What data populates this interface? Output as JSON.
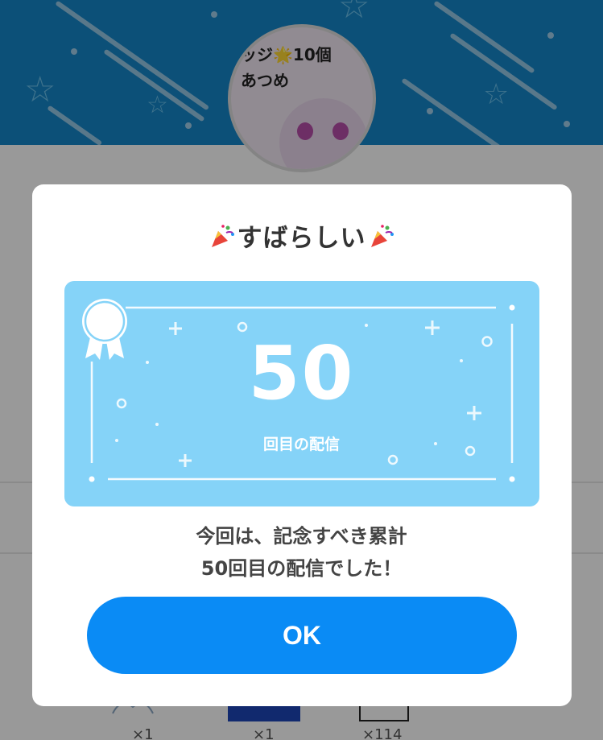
{
  "background": {
    "avatar_text_line1": "ッジ🌟10個",
    "avatar_text_line2": "あつめ",
    "gift_counts": [
      "×1",
      "×1",
      "×114"
    ]
  },
  "modal": {
    "title": "すばらしい",
    "title_icon": "party-popper-icon",
    "badge_icon": "award-ribbon-icon",
    "milestone_number": "50",
    "milestone_caption": "回目の配信",
    "message_line1": "今回は、記念すべき累計",
    "message_line2": "50回目の配信でした！",
    "ok_label": "OK"
  },
  "colors": {
    "header_blue": "#1586c9",
    "card_blue": "#85d3f8",
    "button_blue": "#0a8bf5"
  }
}
